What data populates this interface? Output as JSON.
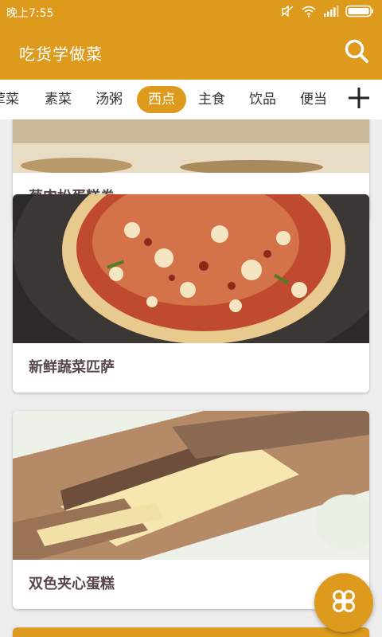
{
  "status_bar": {
    "time": "晚上7:55"
  },
  "app_bar": {
    "title": "吃货学做菜",
    "search_icon": "search-icon"
  },
  "tabs": {
    "items": [
      {
        "label": "荤菜"
      },
      {
        "label": "素菜"
      },
      {
        "label": "汤粥"
      },
      {
        "label": "西点"
      },
      {
        "label": "主食"
      },
      {
        "label": "饮品"
      },
      {
        "label": "便当"
      }
    ],
    "active_index": 3,
    "add_icon": "plus-icon"
  },
  "recipes": [
    {
      "title": "葱肉松蛋糕卷"
    },
    {
      "title": "新鲜蔬菜匹萨"
    },
    {
      "title": "双色夹心蛋糕"
    }
  ],
  "fab": {
    "icon": "clover-icon"
  },
  "colors": {
    "accent": "#dd9a1d",
    "title_text": "#5a4848",
    "background": "#ededed"
  }
}
